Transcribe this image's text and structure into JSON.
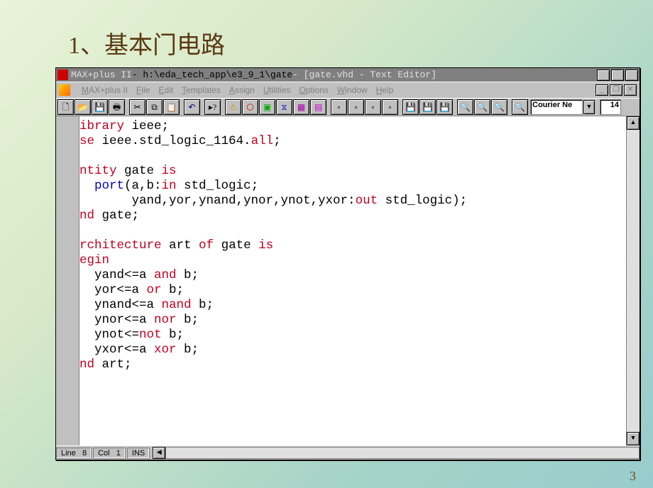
{
  "page_title": "1、基本门电路",
  "window": {
    "title_app": "MAX+plus II",
    "title_path": " - h:\\eda_tech_app\\e3_9_1\\gate",
    "title_doc": " - [gate.vhd - Text Editor]"
  },
  "menu": {
    "app": "MAX+plus II",
    "file": "File",
    "edit": "Edit",
    "templates": "Templates",
    "assign": "Assign",
    "utilities": "Utilities",
    "options": "Options",
    "window": "Window",
    "help": "Help"
  },
  "toolbar": {
    "font_name": "Courier Ne",
    "font_size": "14"
  },
  "code": {
    "l1a": "ibrary",
    "l1b": " ieee;",
    "l2a": "se",
    "l2b": " ieee.std_logic_1164.",
    "l2c": "all",
    "l2d": ";",
    "l4a": "ntity",
    "l4b": " gate ",
    "l4c": "is",
    "l5a": "  port",
    "l5b": "(a,b:",
    "l5c": "in",
    "l5d": " std_logic;",
    "l6a": "       yand,yor,ynand,ynor,ynot,yxor:",
    "l6b": "out",
    "l6c": " std_logic);",
    "l7a": "nd",
    "l7b": " gate;",
    "l9a": "rchitecture",
    "l9b": " art ",
    "l9c": "of",
    "l9d": " gate ",
    "l9e": "is",
    "l10a": "egin",
    "l11a": "  yand<=a ",
    "l11b": "and",
    "l11c": " b;",
    "l12a": "  yor<=a ",
    "l12b": "or",
    "l12c": " b;",
    "l13a": "  ynand<=a ",
    "l13b": "nand",
    "l13c": " b;",
    "l14a": "  ynor<=a ",
    "l14b": "nor",
    "l14c": " b;",
    "l15a": "  ynot<=",
    "l15b": "not",
    "l15c": " b;",
    "l16a": "  yxor<=a ",
    "l16b": "xor",
    "l16c": " b;",
    "l17a": "nd",
    "l17b": " art;"
  },
  "status": {
    "line_label": "Line",
    "line_val": "8",
    "col_label": "Col",
    "col_val": "1",
    "ins": "INS"
  },
  "slide_number": "3"
}
